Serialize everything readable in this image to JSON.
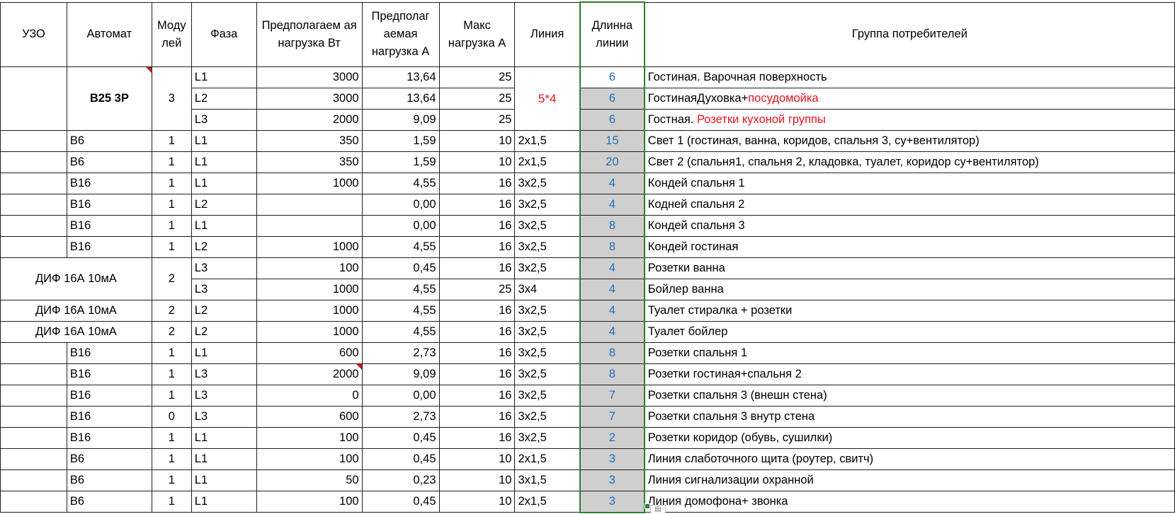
{
  "headers": {
    "uzo": "УЗО",
    "automat": "Автомат",
    "modules": "Моду лей",
    "phase": "Фаза",
    "load_w": "Предполагаем ая нагрузка Вт",
    "load_a": "Предполаг аемая нагрузка А",
    "max_load": "Макс нагрузка А",
    "line": "Линия",
    "length": "Длинна линии",
    "group": "Группа потребителей"
  },
  "group_top": {
    "automat": "B25 3P",
    "modules": "3",
    "line": "5*4"
  },
  "group_dif": {
    "uzo": "ДИФ 16А 10мА",
    "modules": "2"
  },
  "rows": [
    {
      "phase": "L1",
      "load_w": "3000",
      "load_a": "13,64",
      "max": "25",
      "length": "6",
      "consumer": "Гостиная. Варочная поверхность"
    },
    {
      "phase": "L2",
      "load_w": "3000",
      "load_a": "13,64",
      "max": "25",
      "length": "6",
      "consumer_a": "ГостинаяДуховка+",
      "consumer_b": "посудомойка"
    },
    {
      "phase": "L3",
      "load_w": "2000",
      "load_a": "9,09",
      "max": "25",
      "length": "6",
      "consumer_a": "Гостная. ",
      "consumer_b": "Розетки кухоной группы"
    },
    {
      "automat": "B6",
      "modules": "1",
      "phase": "L1",
      "load_w": "350",
      "load_a": "1,59",
      "max": "10",
      "line": "2x1,5",
      "length": "15",
      "consumer": "Свет 1 (гостиная, ванна, коридов, спальня 3, су+вентилятор)"
    },
    {
      "automat": "B6",
      "modules": "1",
      "phase": "L1",
      "load_w": "350",
      "load_a": "1,59",
      "max": "10",
      "line": "2x1,5",
      "length": "20",
      "consumer": "Свет 2 (спальня1, спальня 2, кладовка, туалет, коридор су+вентилятор)"
    },
    {
      "automat": "B16",
      "modules": "1",
      "phase": "L1",
      "load_w": "1000",
      "load_a": "4,55",
      "max": "16",
      "line": "3x2,5",
      "length": "4",
      "consumer": "Кондей спальня 1"
    },
    {
      "automat": "B16",
      "modules": "1",
      "phase": "L2",
      "load_w": "",
      "load_a": "0,00",
      "max": "16",
      "line": "3x2,5",
      "length": "4",
      "consumer": "Кодней спальня 2"
    },
    {
      "automat": "B16",
      "modules": "1",
      "phase": "L1",
      "load_w": "",
      "load_a": "0,00",
      "max": "16",
      "line": "3x2,5",
      "length": "8",
      "consumer": "Кондей спальня 3"
    },
    {
      "automat": "B16",
      "modules": "1",
      "phase": "L2",
      "load_w": "1000",
      "load_a": "4,55",
      "max": "16",
      "line": "3x2,5",
      "length": "8",
      "consumer": "Кондей гостиная"
    },
    {
      "phase": "L3",
      "load_w": "100",
      "load_a": "0,45",
      "max": "16",
      "line": "3x2,5",
      "length": "4",
      "consumer": "Розетки ванна"
    },
    {
      "phase": "L3",
      "load_w": "1000",
      "load_a": "4,55",
      "max": "25",
      "line": "3x4",
      "length": "4",
      "consumer": "Бойлер ванна"
    },
    {
      "uzo": "ДИФ 16А 10мА",
      "modules": "2",
      "phase": "L2",
      "load_w": "1000",
      "load_a": "4,55",
      "max": "16",
      "line": "3x2,5",
      "length": "4",
      "consumer": "Туалет стиралка + розетки"
    },
    {
      "uzo": "ДИФ 16А 10мА",
      "modules": "2",
      "phase": "L2",
      "load_w": "1000",
      "load_a": "4,55",
      "max": "16",
      "line": "3x2,5",
      "length": "4",
      "consumer": "Туалет  бойлер"
    },
    {
      "automat": "B16",
      "modules": "1",
      "phase": "L1",
      "load_w": "600",
      "load_a": "2,73",
      "max": "16",
      "line": "3x2,5",
      "length": "8",
      "consumer": "Розетки спальня 1"
    },
    {
      "automat": "B16",
      "modules": "1",
      "phase": "L3",
      "load_w": "2000",
      "load_a": "9,09",
      "max": "16",
      "line": "3x2,5",
      "length": "8",
      "consumer": "Розетки гостиная+спальня 2"
    },
    {
      "automat": "B16",
      "modules": "1",
      "phase": "L3",
      "load_w": "0",
      "load_a": "0,00",
      "max": "16",
      "line": "3x2,5",
      "length": "7",
      "consumer": "Розетки спальня 3 (внешн стена)"
    },
    {
      "automat": "B16",
      "modules": "0",
      "phase": "L3",
      "load_w": "600",
      "load_a": "2,73",
      "max": "16",
      "line": "3x2,5",
      "length": "7",
      "consumer": "Розетки спальня 3 внутр стена"
    },
    {
      "automat": "B16",
      "modules": "1",
      "phase": "L1",
      "load_w": "100",
      "load_a": "0,45",
      "max": "16",
      "line": "3x2,5",
      "length": "2",
      "consumer": "Розетки коридор (обувь, сушилки)"
    },
    {
      "automat": "B6",
      "modules": "1",
      "phase": "L1",
      "load_w": "100",
      "load_a": "0,45",
      "max": "10",
      "line": "2x1,5",
      "length": "3",
      "consumer": "Линия слаботочного щита (роутер, свитч)"
    },
    {
      "automat": "B6",
      "modules": "1",
      "phase": "L1",
      "load_w": "50",
      "load_a": "0,23",
      "max": "10",
      "line": "3x1,5",
      "length": "3",
      "consumer": "Линия сигнализации охранной"
    },
    {
      "automat": "B6",
      "modules": "1",
      "phase": "L1",
      "load_w": "100",
      "load_a": "0,45",
      "max": "10",
      "line": "2x1,5",
      "length": "3",
      "consumer": "Линия домофона+ звонка"
    }
  ],
  "icons": {
    "paste_options": "paste-options-icon"
  },
  "colors": {
    "selection": "#2e7d32",
    "red_text": "#e0141e",
    "length_text": "#1f6fb8",
    "selected_fill": "#cfcfcf"
  }
}
